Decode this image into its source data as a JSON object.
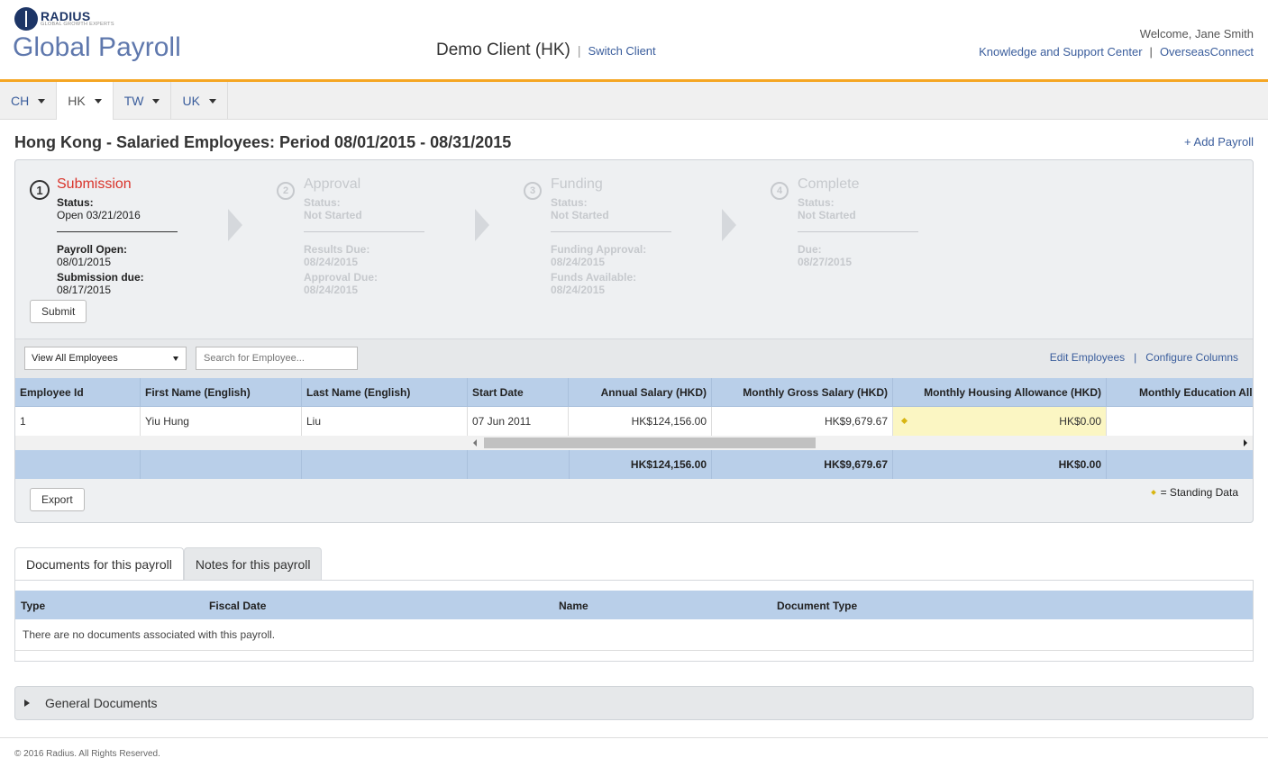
{
  "header": {
    "logo_name": "RADIUS",
    "logo_tagline": "GLOBAL GROWTH EXPERTS",
    "app_title": "Global Payroll",
    "client_name": "Demo Client (HK)",
    "client_separator": "|",
    "switch_client": "Switch Client",
    "welcome": "Welcome, Jane Smith",
    "link_knowledge": "Knowledge and Support Center",
    "link_separator": "|",
    "link_overseas": "OverseasConnect"
  },
  "colors": {
    "accent_orange": "#f5a623",
    "link_blue": "#3a5d9c",
    "title_blue": "#5f78ad",
    "grid_header": "#b9cfe9",
    "step_active": "#d9342b",
    "standing_data": "#fbf6c3"
  },
  "country_tabs": [
    {
      "label": "CH",
      "active": false
    },
    {
      "label": "HK",
      "active": true
    },
    {
      "label": "TW",
      "active": false
    },
    {
      "label": "UK",
      "active": false
    }
  ],
  "page": {
    "period_title": "Hong Kong - Salaried Employees: Period 08/01/2015 - 08/31/2015",
    "add_payroll": "+ Add Payroll"
  },
  "steps": [
    {
      "num": "1",
      "title": "Submission",
      "status_label": "Status:",
      "status_value": "Open 03/21/2016",
      "field1_label": "Payroll Open:",
      "field1_value": "08/01/2015",
      "field2_label": "Submission due:",
      "field2_value": "08/17/2015"
    },
    {
      "num": "2",
      "title": "Approval",
      "status_label": "Status:",
      "status_value": "Not Started",
      "field1_label": "Results Due:",
      "field1_value": "08/24/2015",
      "field2_label": "Approval Due:",
      "field2_value": "08/24/2015"
    },
    {
      "num": "3",
      "title": "Funding",
      "status_label": "Status:",
      "status_value": "Not Started",
      "field1_label": "Funding Approval:",
      "field1_value": "08/24/2015",
      "field2_label": "Funds Available:",
      "field2_value": "08/24/2015"
    },
    {
      "num": "4",
      "title": "Complete",
      "status_label": "Status:",
      "status_value": "Not Started",
      "field1_label": "Due:",
      "field1_value": "08/27/2015"
    }
  ],
  "submit_label": "Submit",
  "filters": {
    "employee_select": "View All Employees",
    "search_placeholder": "Search for Employee...",
    "edit_employees": "Edit Employees",
    "link_separator": "|",
    "configure_columns": "Configure Columns"
  },
  "grid": {
    "columns": [
      "Employee Id",
      "First Name (English)",
      "Last Name (English)",
      "Start Date",
      "Annual Salary (HKD)",
      "Monthly Gross Salary (HKD)",
      "Monthly Housing Allowance (HKD)",
      "Monthly Education Allo"
    ],
    "rows": [
      [
        "1",
        "Yiu Hung",
        "Liu",
        "07 Jun 2011",
        "HK$124,156.00",
        "HK$9,679.67",
        "HK$0.00",
        ""
      ]
    ],
    "totals": [
      "",
      "",
      "",
      "",
      "HK$124,156.00",
      "HK$9,679.67",
      "HK$0.00",
      ""
    ]
  },
  "export_label": "Export",
  "legend": "= Standing Data",
  "documents": {
    "tab_documents": "Documents for this payroll",
    "tab_notes": "Notes for this payroll",
    "columns": [
      "Type",
      "Fiscal Date",
      "Name",
      "Document Type"
    ],
    "empty_message": "There are no documents associated with this payroll."
  },
  "general_documents": "General Documents",
  "footer": "© 2016 Radius. All Rights Reserved."
}
